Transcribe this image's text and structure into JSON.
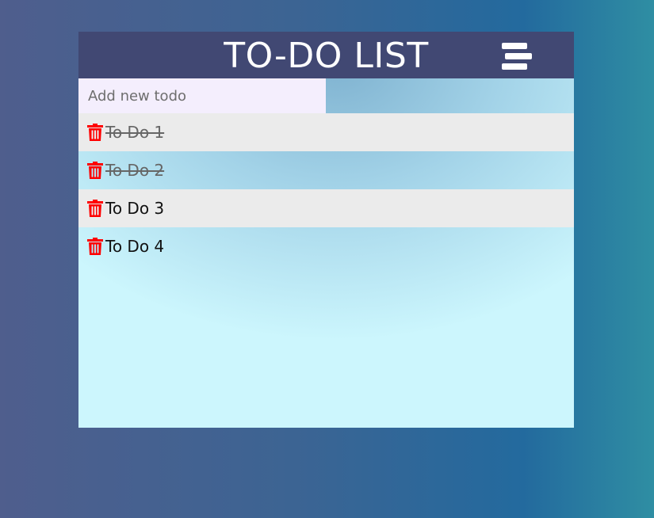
{
  "header": {
    "title": "TO-DO LIST"
  },
  "add": {
    "placeholder": "Add new todo",
    "value": ""
  },
  "todos": [
    {
      "text": "To Do 1",
      "done": true
    },
    {
      "text": "To Do 2",
      "done": true
    },
    {
      "text": "To Do 3",
      "done": false
    },
    {
      "text": "To Do 4",
      "done": false
    }
  ],
  "icons": {
    "menu": "hamburger-menu-icon",
    "delete": "trash-icon"
  },
  "colors": {
    "header_bg": "#414873",
    "delete_icon": "#ff0000",
    "input_bg": "#f4eefd"
  }
}
